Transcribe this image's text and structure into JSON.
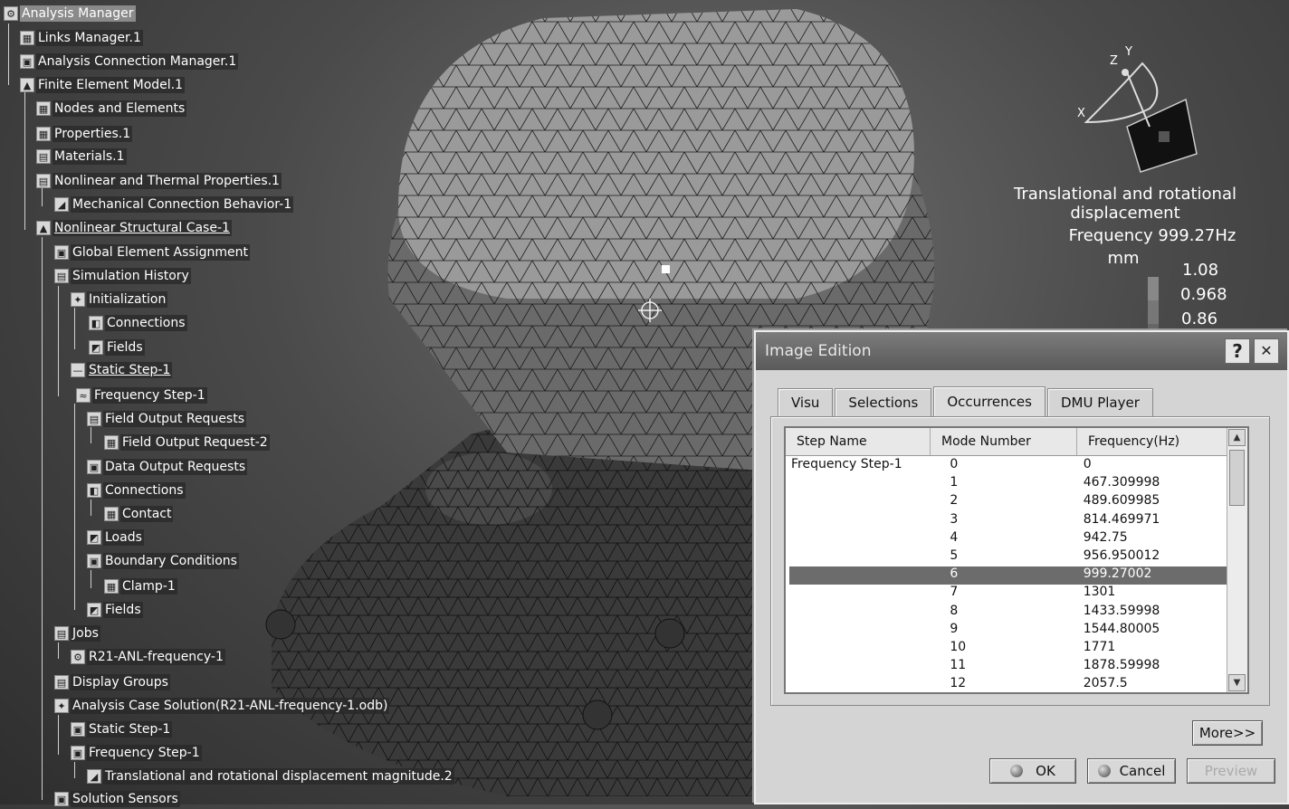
{
  "tree": {
    "items": [
      {
        "label": "Analysis Manager",
        "icon": "analysis-manager-icon",
        "glyph": "⚙"
      },
      {
        "label": "Links Manager.1",
        "icon": "links-manager-icon",
        "glyph": "▦"
      },
      {
        "label": "Analysis Connection Manager.1",
        "icon": "connection-manager-icon",
        "glyph": "▣"
      },
      {
        "label": "Finite Element Model.1",
        "icon": "fem-model-icon",
        "glyph": "▲"
      },
      {
        "label": "Nodes and Elements",
        "icon": "mesh-icon",
        "glyph": "▦"
      },
      {
        "label": "Properties.1",
        "icon": "properties-icon",
        "glyph": "▦"
      },
      {
        "label": "Materials.1",
        "icon": "materials-icon",
        "glyph": "▤"
      },
      {
        "label": "Nonlinear and Thermal Properties.1",
        "icon": "thermal-properties-icon",
        "glyph": "▤"
      },
      {
        "label": "Mechanical Connection Behavior-1",
        "icon": "connection-behavior-icon",
        "glyph": "◢"
      },
      {
        "label": "Nonlinear Structural Case-1",
        "icon": "structural-case-icon",
        "glyph": "▲"
      },
      {
        "label": "Global Element Assignment",
        "icon": "element-assignment-icon",
        "glyph": "▣"
      },
      {
        "label": "Simulation History",
        "icon": "history-icon",
        "glyph": "▤"
      },
      {
        "label": "Initialization",
        "icon": "initialization-icon",
        "glyph": "✦"
      },
      {
        "label": "Connections",
        "icon": "connections-icon",
        "glyph": "◧"
      },
      {
        "label": "Fields",
        "icon": "fields-icon",
        "glyph": "◩"
      },
      {
        "label": "Static Step-1",
        "icon": "static-step-icon",
        "glyph": "—"
      },
      {
        "label": "Frequency Step-1",
        "icon": "frequency-step-icon",
        "glyph": "≈"
      },
      {
        "label": "Field Output Requests",
        "icon": "field-output-icon",
        "glyph": "▤"
      },
      {
        "label": "Field Output Request-2",
        "icon": "field-output-request-icon",
        "glyph": "▦"
      },
      {
        "label": "Data Output Requests",
        "icon": "data-output-icon",
        "glyph": "▣"
      },
      {
        "label": "Connections",
        "icon": "connections-icon",
        "glyph": "◧"
      },
      {
        "label": "Contact",
        "icon": "contact-icon",
        "glyph": "▦"
      },
      {
        "label": "Loads",
        "icon": "loads-icon",
        "glyph": "◩"
      },
      {
        "label": "Boundary Conditions",
        "icon": "boundary-conditions-icon",
        "glyph": "▣"
      },
      {
        "label": "Clamp-1",
        "icon": "clamp-icon",
        "glyph": "▦"
      },
      {
        "label": "Fields",
        "icon": "fields-icon",
        "glyph": "◩"
      },
      {
        "label": "Jobs",
        "icon": "jobs-icon",
        "glyph": "▤"
      },
      {
        "label": "R21-ANL-frequency-1",
        "icon": "job-icon",
        "glyph": "⚙"
      },
      {
        "label": "Display Groups",
        "icon": "display-groups-icon",
        "glyph": "▤"
      },
      {
        "label": "Analysis Case Solution(R21-ANL-frequency-1.odb)",
        "icon": "solution-icon",
        "glyph": "✦"
      },
      {
        "label": "Static Step-1",
        "icon": "static-step-result-icon",
        "glyph": "▣"
      },
      {
        "label": "Frequency Step-1",
        "icon": "frequency-step-result-icon",
        "glyph": "▣"
      },
      {
        "label": "Translational and rotational displacement magnitude.2",
        "icon": "displacement-image-icon",
        "glyph": "◢"
      },
      {
        "label": "Solution Sensors",
        "icon": "sensors-icon",
        "glyph": "▣"
      }
    ]
  },
  "compass": {
    "x": "X",
    "y": "Y",
    "z": "Z"
  },
  "legend": {
    "title": "Translational and rotational displacement",
    "frequency": "Frequency 999.27Hz",
    "unit": "mm",
    "values": [
      "1.08",
      "0.968",
      "0.86"
    ]
  },
  "dialog": {
    "title": "Image Edition",
    "help": "?",
    "close": "✕",
    "tabs": [
      "Visu",
      "Selections",
      "Occurrences",
      "DMU Player"
    ],
    "active_tab": "Occurrences",
    "columns": [
      "Step Name",
      "Mode Number",
      "Frequency(Hz)"
    ],
    "rows": [
      {
        "step": "Frequency Step-1",
        "mode": "0",
        "freq": "0"
      },
      {
        "step": "",
        "mode": "1",
        "freq": "467.309998"
      },
      {
        "step": "",
        "mode": "2",
        "freq": "489.609985"
      },
      {
        "step": "",
        "mode": "3",
        "freq": "814.469971"
      },
      {
        "step": "",
        "mode": "4",
        "freq": "942.75"
      },
      {
        "step": "",
        "mode": "5",
        "freq": "956.950012"
      },
      {
        "step": "",
        "mode": "6",
        "freq": "999.27002"
      },
      {
        "step": "",
        "mode": "7",
        "freq": "1301"
      },
      {
        "step": "",
        "mode": "8",
        "freq": "1433.59998"
      },
      {
        "step": "",
        "mode": "9",
        "freq": "1544.80005"
      },
      {
        "step": "",
        "mode": "10",
        "freq": "1771"
      },
      {
        "step": "",
        "mode": "11",
        "freq": "1878.59998"
      },
      {
        "step": "",
        "mode": "12",
        "freq": "2057.5"
      }
    ],
    "selected_mode": "6",
    "more": "More>>",
    "ok": "OK",
    "cancel": "Cancel",
    "preview": "Preview"
  }
}
